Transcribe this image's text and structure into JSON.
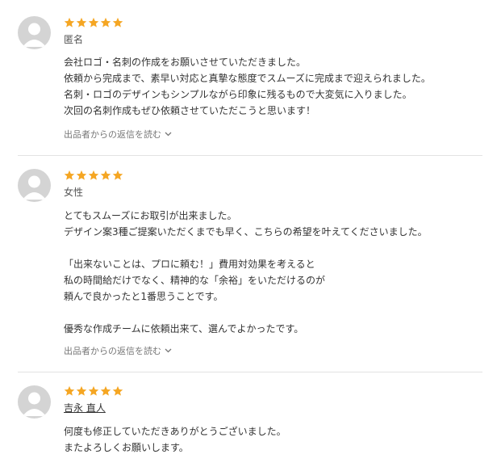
{
  "colors": {
    "star": "#f5a623",
    "avatar_bg": "#d4d4d4",
    "avatar_fg": "#ffffff"
  },
  "reviews": [
    {
      "rating": 5,
      "author": "匿名",
      "lines": [
        "会社ロゴ・名刺の作成をお願いさせていただきました。",
        "依頼から完成まで、素早い対応と真摯な態度でスムーズに完成まで迎えられました。",
        "名刺・ロゴのデザインもシンプルながら印象に残るもので大変気に入りました。",
        "次回の名刺作成もぜひ依頼させていただこうと思います！"
      ],
      "reply_label": "出品者からの返信を読む"
    },
    {
      "rating": 5,
      "author": "女性",
      "lines": [
        "とてもスムーズにお取引が出来ました。",
        "デザイン案3種ご提案いただくまでも早く、こちらの希望を叶えてくださいました。",
        "",
        "「出来ないことは、プロに頼む！」費用対効果を考えると",
        "私の時間給だけでなく、精神的な「余裕」をいただけるのが",
        "頼んで良かったと1番思うことです。",
        "",
        "優秀な作成チームに依頼出来て、選んでよかったです。"
      ],
      "reply_label": "出品者からの返信を読む"
    },
    {
      "rating": 5,
      "author": "吉永 直人",
      "lines": [
        "何度も修正していただきありがとうございました。",
        "またよろしくお願いします。"
      ]
    }
  ]
}
